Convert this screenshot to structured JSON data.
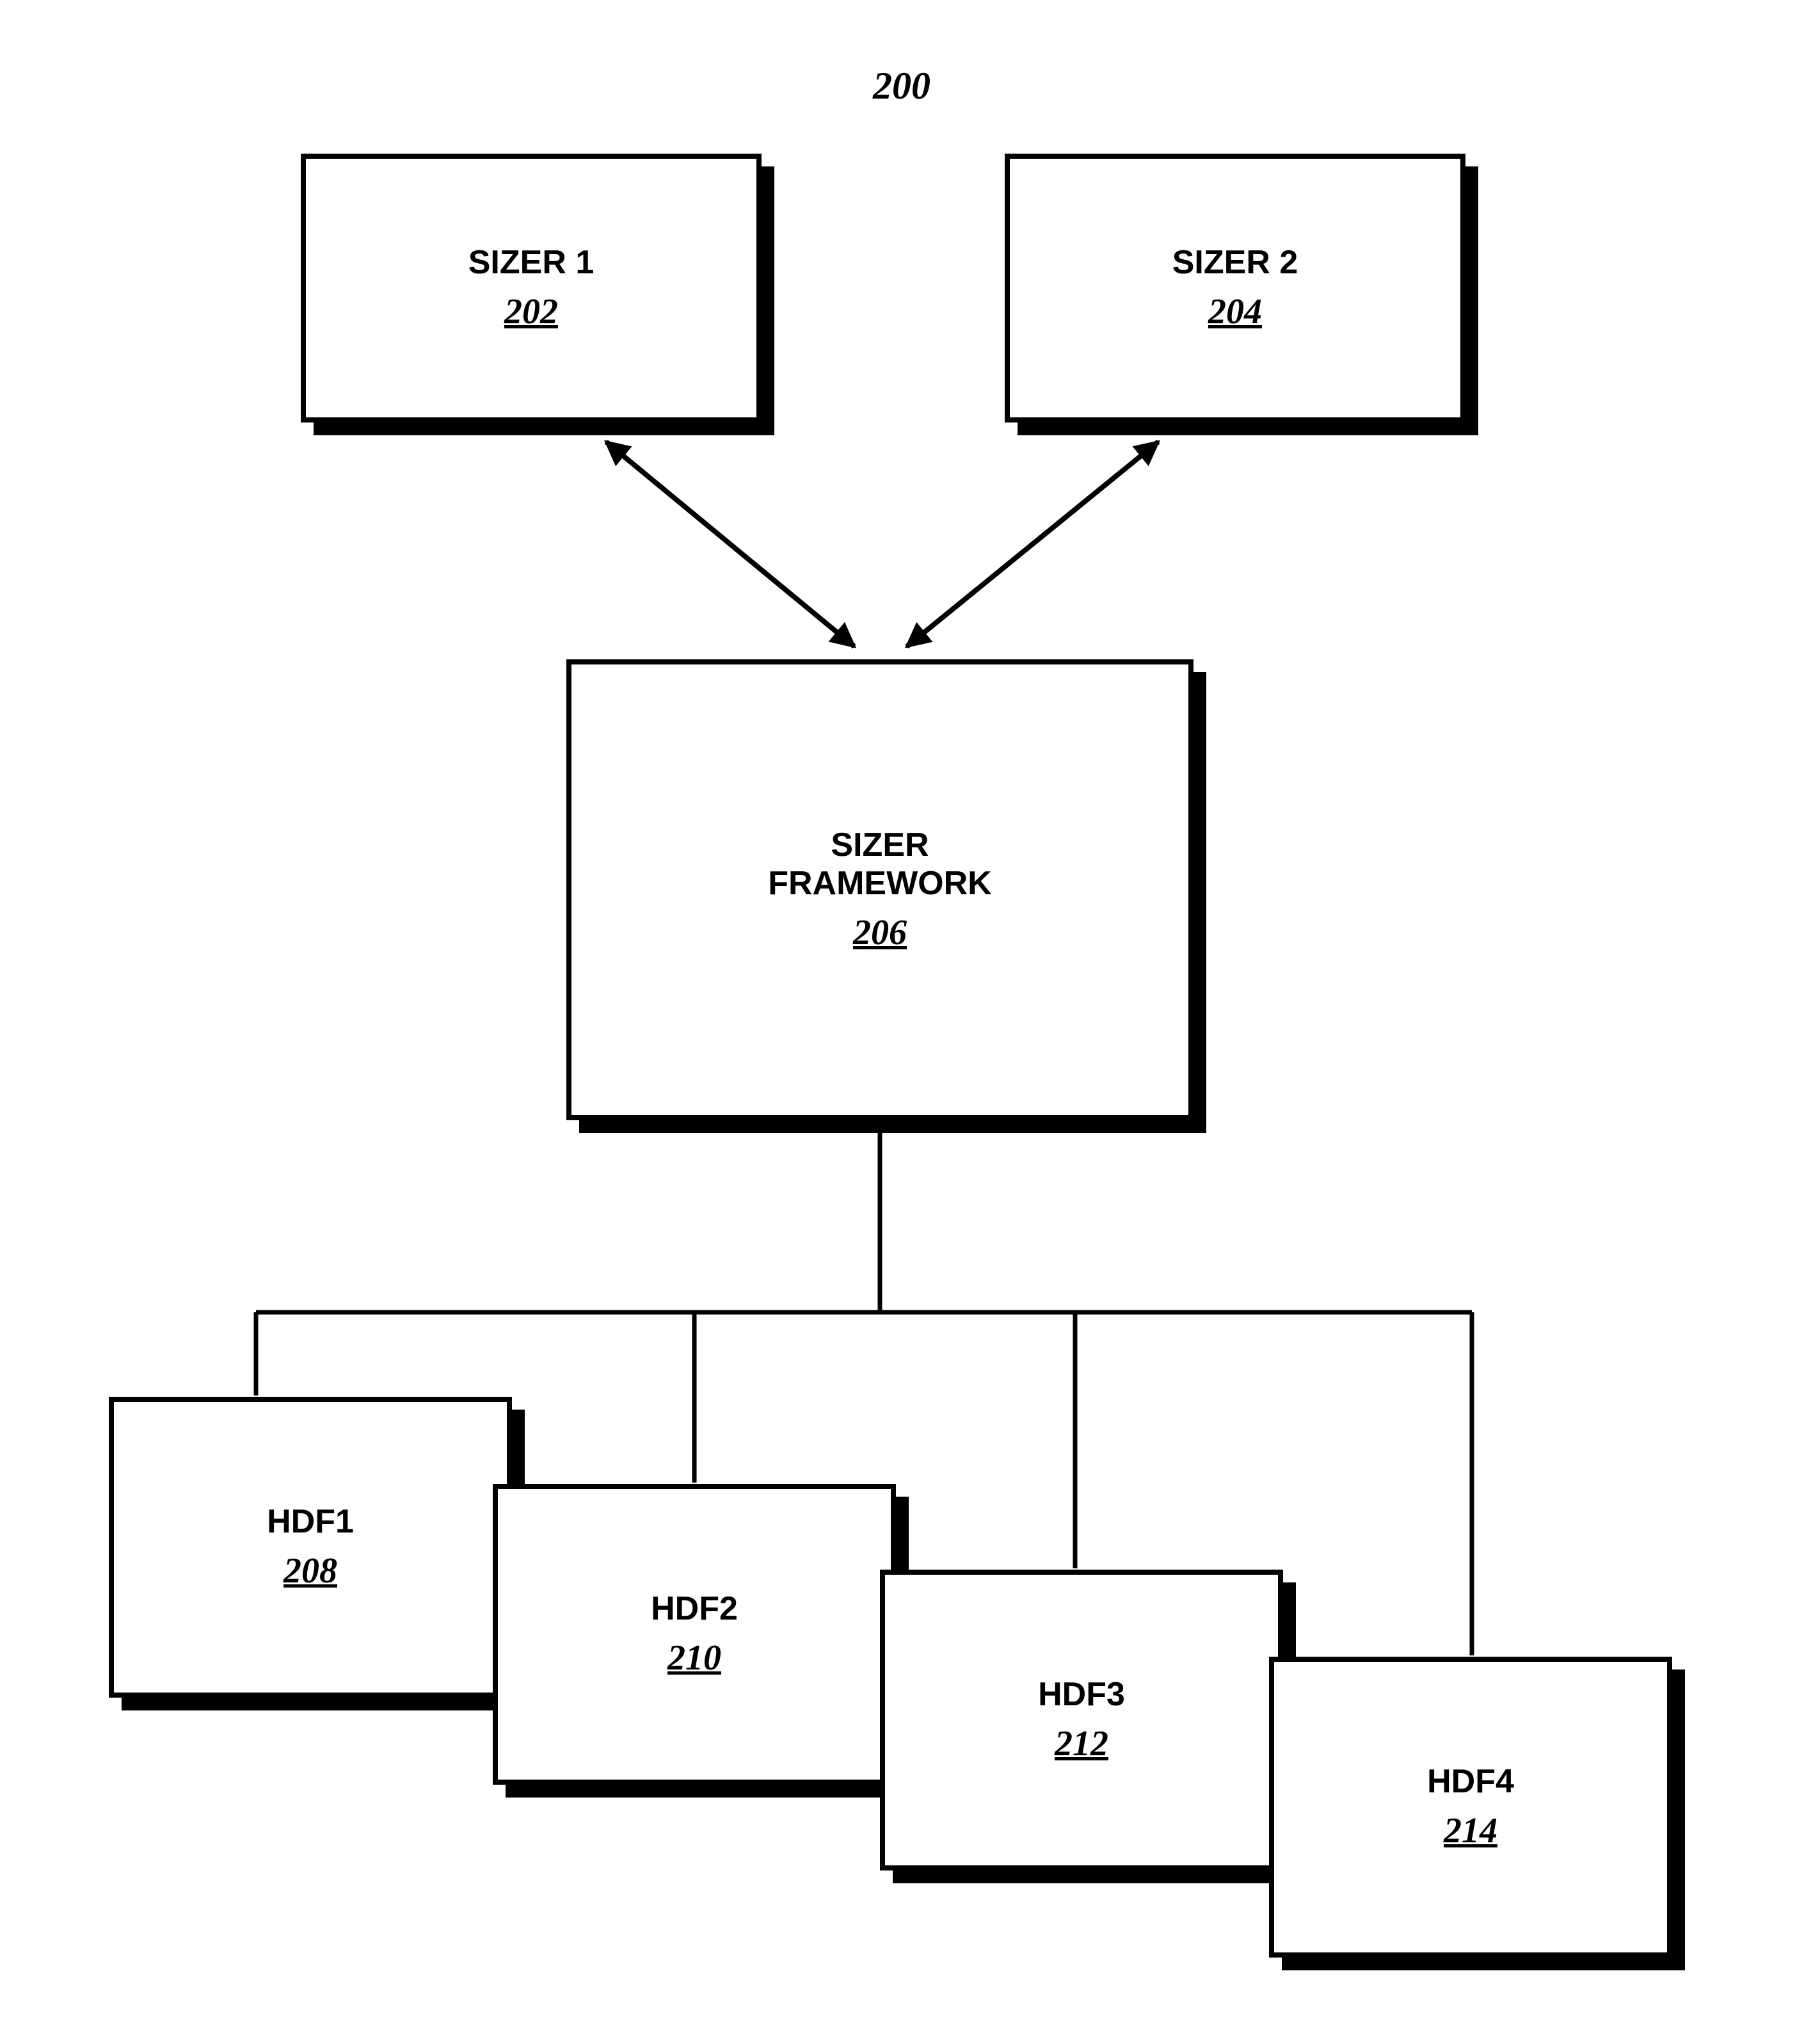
{
  "figure_number": "200",
  "boxes": {
    "sizer1": {
      "label": "SIZER 1",
      "ref": "202"
    },
    "sizer2": {
      "label": "SIZER 2",
      "ref": "204"
    },
    "framework": {
      "label": "SIZER\nFRAMEWORK",
      "ref": "206"
    },
    "hdf1": {
      "label": "HDF1",
      "ref": "208"
    },
    "hdf2": {
      "label": "HDF2",
      "ref": "210"
    },
    "hdf3": {
      "label": "HDF3",
      "ref": "212"
    },
    "hdf4": {
      "label": "HDF4",
      "ref": "214"
    }
  },
  "chart_data": {
    "type": "block-diagram",
    "title": "200",
    "nodes": [
      {
        "id": "202",
        "label": "SIZER 1"
      },
      {
        "id": "204",
        "label": "SIZER 2"
      },
      {
        "id": "206",
        "label": "SIZER FRAMEWORK"
      },
      {
        "id": "208",
        "label": "HDF1"
      },
      {
        "id": "210",
        "label": "HDF2"
      },
      {
        "id": "212",
        "label": "HDF3"
      },
      {
        "id": "214",
        "label": "HDF4"
      }
    ],
    "edges": [
      {
        "from": "202",
        "to": "206",
        "bidirectional": true
      },
      {
        "from": "204",
        "to": "206",
        "bidirectional": true
      },
      {
        "from": "206",
        "to": "208",
        "bidirectional": false
      },
      {
        "from": "206",
        "to": "210",
        "bidirectional": false
      },
      {
        "from": "206",
        "to": "212",
        "bidirectional": false
      },
      {
        "from": "206",
        "to": "214",
        "bidirectional": false
      }
    ]
  }
}
